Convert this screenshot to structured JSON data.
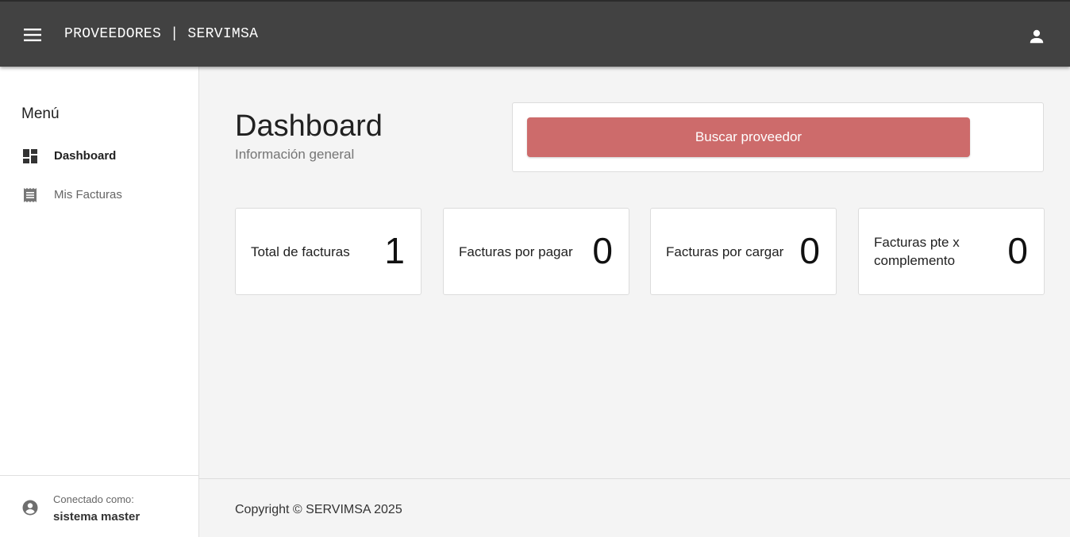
{
  "header": {
    "title": "PROVEEDORES | SERVIMSA",
    "menu_icon": "menu-icon",
    "user_icon": "person-icon",
    "background": "#424242"
  },
  "sidebar": {
    "heading": "Menú",
    "items": [
      {
        "label": "Dashboard",
        "icon": "dashboard-icon",
        "active": true
      },
      {
        "label": "Mis Facturas",
        "icon": "receipt-icon",
        "active": false
      }
    ],
    "footer": {
      "connected_label": "Conectado como:",
      "user_name": "sistema master",
      "icon": "account-circle-icon"
    }
  },
  "main": {
    "title": "Dashboard",
    "subtitle": "Información general",
    "search_button_label": "Buscar proveedor",
    "accent": "#cd6b6b",
    "stats": [
      {
        "label": "Total de facturas",
        "value": "1"
      },
      {
        "label": "Facturas por pagar",
        "value": "0"
      },
      {
        "label": "Facturas por cargar",
        "value": "0"
      },
      {
        "label": "Facturas pte x complemento",
        "value": "0"
      }
    ]
  },
  "footer": {
    "copyright": "Copyright © SERVIMSA 2025"
  }
}
